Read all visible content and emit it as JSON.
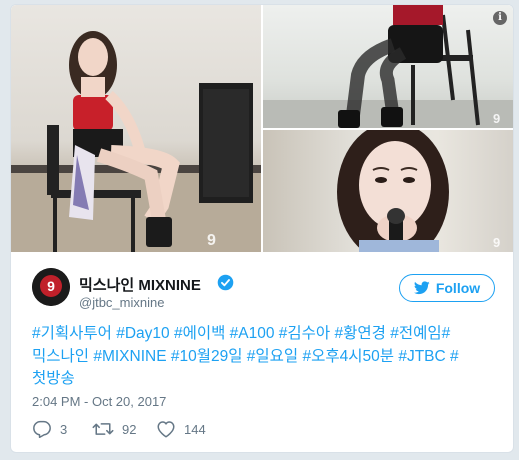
{
  "media": {
    "watermark": "9",
    "info_icon": "i"
  },
  "user": {
    "display_name": "믹스나인 MIXNINE",
    "handle": "@jtbc_mixnine",
    "avatar_text": "9",
    "verified": true
  },
  "follow_button": {
    "label": "Follow"
  },
  "tweet": {
    "lines": [
      "#기획사투어 #Day10 #에이백 #A100 #김수아 #황연경 #전예임#",
      "믹스나인 #MIXNINE #10월29일 #일요일 #오후4시50분 #JTBC #",
      "첫방송"
    ],
    "timestamp": "2:04 PM - Oct 20, 2017"
  },
  "actions": {
    "reply_count": "3",
    "retweet_count": "92",
    "like_count": "144"
  },
  "colors": {
    "accent": "#1da1f2",
    "muted": "#657786",
    "text": "#14171a"
  }
}
